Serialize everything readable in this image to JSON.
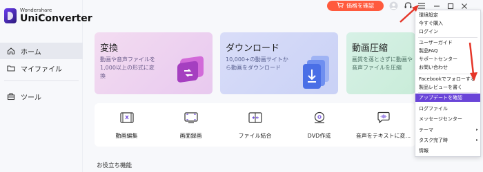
{
  "app": {
    "brand_small": "Wondershare",
    "brand_name": "UniConverter",
    "accent_color": "#6a45d8"
  },
  "sidebar": {
    "items": [
      {
        "label": "ホーム",
        "icon": "home-icon",
        "active": true
      },
      {
        "label": "マイファイル",
        "icon": "folder-icon",
        "active": false
      },
      {
        "label": "ツール",
        "icon": "toolbox-icon",
        "active": false
      }
    ]
  },
  "topbar": {
    "buy_label": "価格を確認",
    "buy_color": "#ff5a3d",
    "icons": [
      "user-icon",
      "headset-icon",
      "hamburger-menu-icon"
    ],
    "window_controls": [
      "minimize-icon",
      "maximize-icon",
      "close-icon"
    ]
  },
  "cards": [
    {
      "title": "変換",
      "desc": "動画や音声ファイルを\n1,000以上の形式に変\n換"
    },
    {
      "title": "ダウンロード",
      "desc": "10,000+の動画サイトか\nら動画をダウンロード"
    },
    {
      "title": "動画圧縮",
      "desc": "画質を落とさずに動画や\n音声ファイルを圧縮"
    }
  ],
  "tools": [
    {
      "label": "動画編集",
      "icon": "video-edit-icon"
    },
    {
      "label": "画面録画",
      "icon": "screen-record-icon"
    },
    {
      "label": "ファイル結合",
      "icon": "file-merge-icon"
    },
    {
      "label": "DVD作成",
      "icon": "dvd-icon"
    },
    {
      "label": "音声をテキストに変...",
      "icon": "speech-to-text-icon"
    }
  ],
  "section_label": "お役立ち機能",
  "menu": {
    "items": [
      {
        "label": "環境設定"
      },
      {
        "label": "今すぐ購入"
      },
      {
        "label": "ログイン"
      },
      {
        "label": "ユーザーガイド"
      },
      {
        "label": "製品FAQ"
      },
      {
        "label": "サポートセンター"
      },
      {
        "label": "お問い合わせ"
      },
      {
        "label": "Facebookでフォローする"
      },
      {
        "label": "製品レビューを書く"
      },
      {
        "label": "アップデートを確認",
        "highlighted": true
      },
      {
        "label": "ログファイル"
      },
      {
        "label": "メッセージセンター"
      },
      {
        "label": "テーマ",
        "submenu": true
      },
      {
        "label": "タスク完了時",
        "submenu": true
      },
      {
        "label": "情報"
      }
    ]
  }
}
